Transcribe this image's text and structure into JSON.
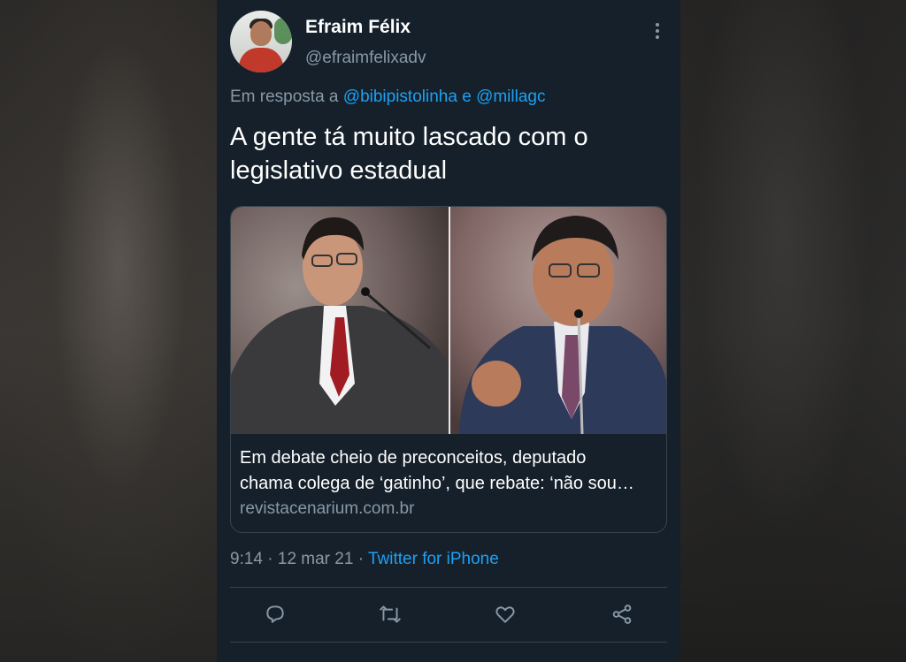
{
  "tweet": {
    "display_name": "Efraim Félix",
    "handle": "@efraimfelixadv",
    "reply_prefix": "Em resposta a",
    "reply_mentions": [
      "@bibipistolinha",
      "@millagc"
    ],
    "reply_conjunction": "e",
    "text": "A gente tá muito lascado com o legislativo estadual",
    "time": "9:14",
    "date": "12 mar 21",
    "source": "Twitter for iPhone",
    "separator": "·"
  },
  "card": {
    "title": "Em debate cheio de preconceitos, deputado\nchama colega de ‘gatinho’, que rebate: ‘não sou…",
    "domain": "revistacenarium.com.br"
  },
  "icons": {
    "more": "more-vertical-icon",
    "reply": "reply-icon",
    "retweet": "retweet-icon",
    "like": "heart-icon",
    "share": "share-icon"
  },
  "colors": {
    "background": "#15202b",
    "text": "#ffffff",
    "secondary": "#8899a6",
    "accent": "#1da1f2",
    "border": "#38444d"
  }
}
